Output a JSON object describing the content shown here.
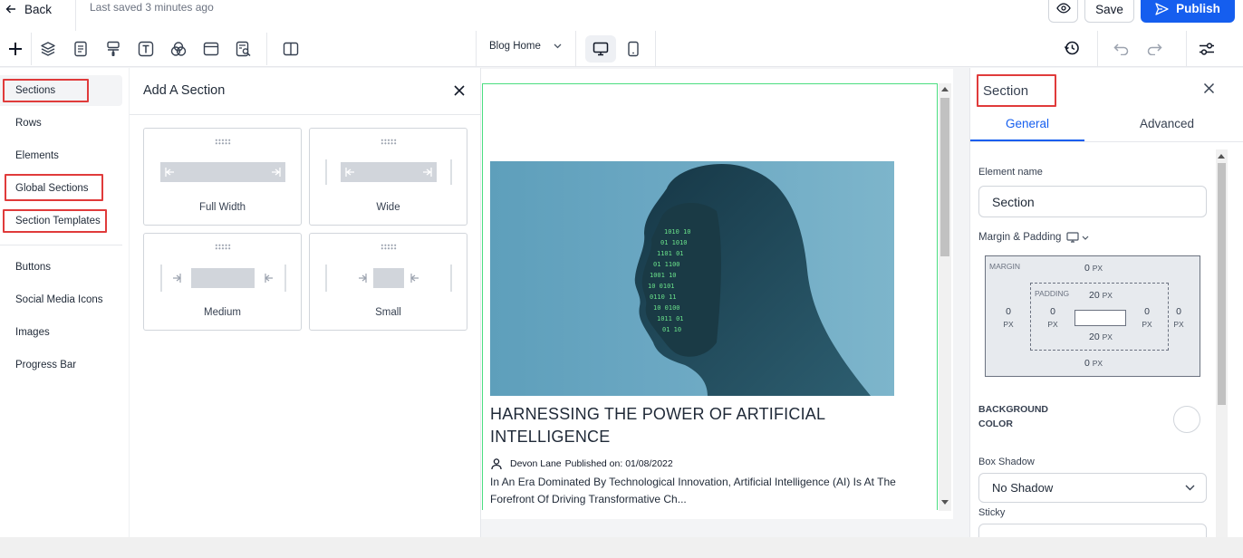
{
  "topbar": {
    "back_label": "Back",
    "saved_status": "Last saved 3 minutes ago",
    "page_select": "Blog Home",
    "save_label": "Save",
    "publish_label": "Publish",
    "accent_color": "#155eef"
  },
  "left_nav": {
    "items": [
      {
        "label": "Sections"
      },
      {
        "label": "Rows"
      },
      {
        "label": "Elements"
      },
      {
        "label": "Global Sections"
      },
      {
        "label": "Section Templates"
      },
      {
        "label": "Buttons"
      },
      {
        "label": "Social Media Icons"
      },
      {
        "label": "Images"
      },
      {
        "label": "Progress Bar"
      }
    ],
    "highlight_color": "#e03b3b"
  },
  "add_section": {
    "title": "Add A Section",
    "options": [
      {
        "label": "Full Width"
      },
      {
        "label": "Wide"
      },
      {
        "label": "Medium"
      },
      {
        "label": "Small"
      }
    ]
  },
  "canvas": {
    "post_title": "HARNESSING THE POWER OF ARTIFICIAL INTELLIGENCE",
    "author": "Devon Lane",
    "published": "Published on: 01/08/2022",
    "excerpt": "In An Era Dominated By Technological Innovation, Artificial Intelligence (AI) Is At The Forefront Of Driving Transformative Ch..."
  },
  "right_panel": {
    "title": "Section",
    "tabs": [
      {
        "label": "General"
      },
      {
        "label": "Advanced"
      }
    ],
    "element_name_label": "Element name",
    "element_name_value": "Section",
    "margin_padding_label": "Margin & Padding",
    "margin_label": "MARGIN",
    "padding_label": "PADDING",
    "margin": {
      "top": "0",
      "right": "0",
      "bottom": "0",
      "left": "0"
    },
    "padding": {
      "top": "20",
      "right": "0",
      "bottom": "20",
      "left": "0"
    },
    "unit": "PX",
    "background_color_label": "BACKGROUND COLOR",
    "box_shadow_label": "Box Shadow",
    "box_shadow_value": "No Shadow",
    "sticky_label": "Sticky"
  }
}
